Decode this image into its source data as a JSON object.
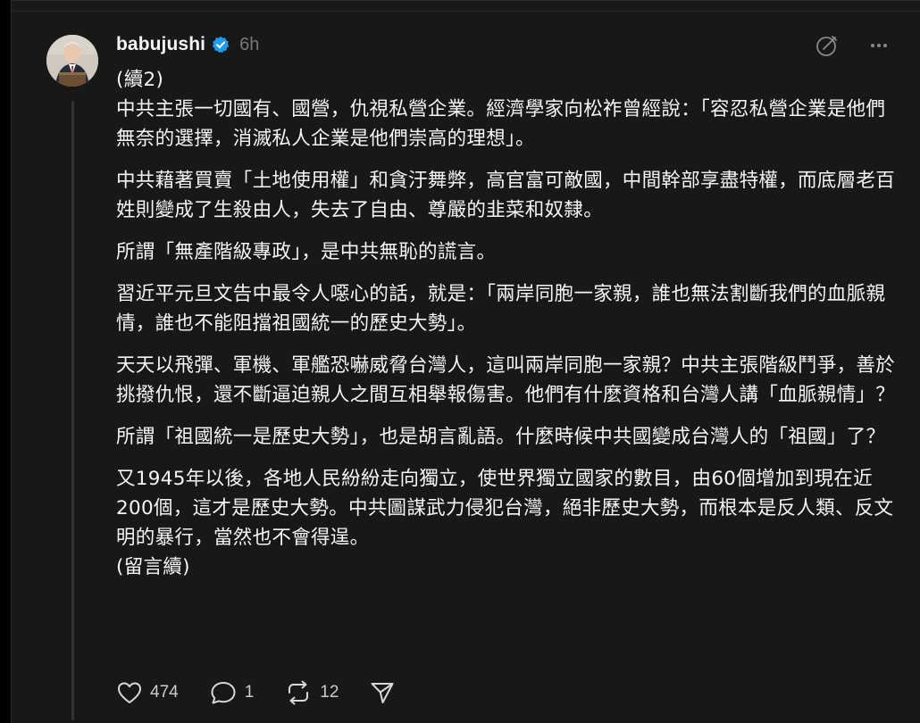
{
  "post": {
    "username": "babujushi",
    "timestamp": "6h",
    "paragraphs": [
      "(續2)\n中共主張一切國有、國營，仇視私營企業。經濟學家向松祚曾經說：「容忍私營企業是他們無奈的選擇，消滅私人企業是他們崇高的理想」。",
      "中共藉著買賣「土地使用權」和貪汙舞弊，高官富可敵國，中間幹部享盡特權，而底層老百姓則變成了生殺由人，失去了自由、尊嚴的韭菜和奴隸。",
      "所謂「無產階級專政」，是中共無恥的謊言。",
      "習近平元旦文告中最令人噁心的話，就是：「兩岸同胞一家親，誰也無法割斷我們的血脈親情，誰也不能阻擋祖國統一的歷史大勢」。",
      "天天以飛彈、軍機、軍艦恐嚇威脅台灣人，這叫兩岸同胞一家親？中共主張階級鬥爭，善於挑撥仇恨，還不斷逼迫親人之間互相舉報傷害。他們有什麼資格和台灣人講「血脈親情」？",
      "所謂「祖國統一是歷史大勢」，也是胡言亂語。什麼時候中共國變成台灣人的「祖國」了？",
      "又1945年以後，各地人民紛紛走向獨立，使世界獨立國家的數目，由60個增加到現在近200個，這才是歷史大勢。中共圖謀武力侵犯台灣，絕非歷史大勢，而根本是反人類、反文明的暴行，當然也不會得逞。\n(留言續)"
    ],
    "actions": {
      "likes": "474",
      "replies": "1",
      "reposts": "12"
    },
    "icons": {
      "verified": "verified-badge-icon",
      "edit": "edit-icon",
      "more": "more-icon",
      "like": "heart-icon",
      "reply": "comment-icon",
      "repost": "repost-icon",
      "share": "share-icon"
    },
    "colors": {
      "background": "#181818",
      "text": "#f3f5f7",
      "muted": "#777777",
      "verified": "#1d9bf0"
    }
  }
}
